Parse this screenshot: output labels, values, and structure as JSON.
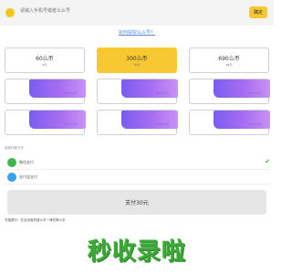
{
  "header": {
    "search_placeholder": "请输入手机号或者么么号",
    "confirm_label": "确定"
  },
  "help_link": "如何获取么么号？",
  "packages": [
    {
      "amount": "60么币",
      "price": "6元",
      "selected": false
    },
    {
      "amount": "300么币",
      "price": "30元",
      "selected": true
    },
    {
      "amount": "690么币",
      "price": "69元",
      "selected": false
    }
  ],
  "promos": [
    {
      "text": "2000么币"
    },
    {
      "text": "2000么币"
    },
    {
      "text": "2000么币"
    },
    {
      "text": "2000么币"
    },
    {
      "text": "2000么币"
    },
    {
      "text": "2000么币"
    }
  ],
  "payment": {
    "title": "选择付款方式",
    "methods": [
      {
        "label": "微信支付",
        "icon": "wechat-icon",
        "selected": true
      },
      {
        "label": "支付宝支付",
        "icon": "alipay-icon",
        "selected": false
      }
    ],
    "pay_button": "支付30元"
  },
  "notice": "充值提示：在此页面充值么币一律兑换么币",
  "watermark": "秒收录啦",
  "colors": {
    "accent": "#f7c832",
    "promo_gradient_start": "#7a5cf2",
    "promo_gradient_end": "#c992f4",
    "wechat": "#3cb84a",
    "alipay": "#37a3ea",
    "watermark": "#3fa63a"
  }
}
